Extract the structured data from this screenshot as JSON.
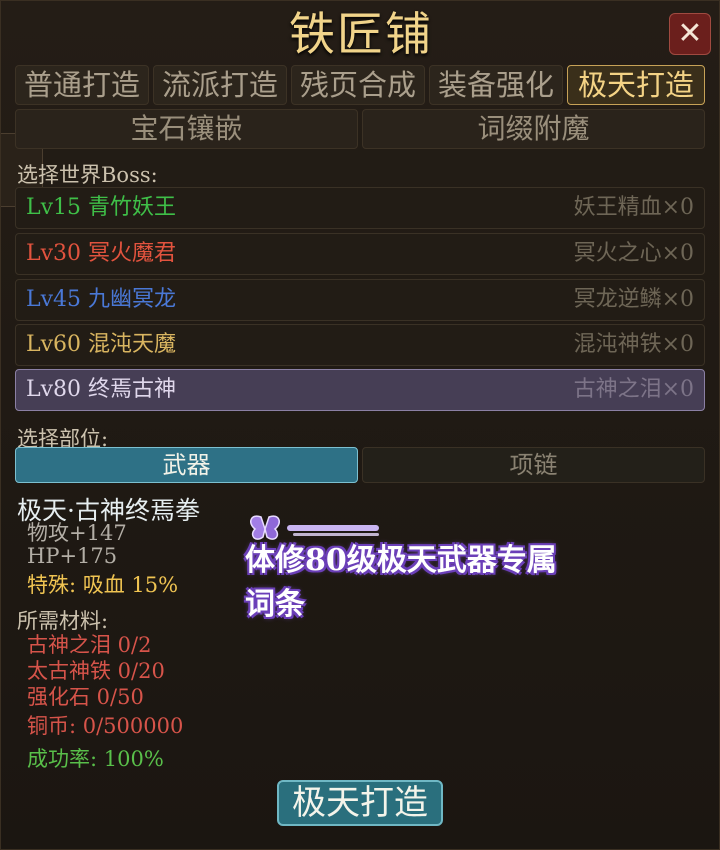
{
  "window": {
    "title": "铁匠铺",
    "close_icon": "close-icon"
  },
  "tabs": [
    {
      "label": "普通打造",
      "active": false
    },
    {
      "label": "流派打造",
      "active": false
    },
    {
      "label": "残页合成",
      "active": false
    },
    {
      "label": "装备强化",
      "active": false
    },
    {
      "label": "极天打造",
      "active": true
    }
  ],
  "subtabs": [
    {
      "label": "宝石镶嵌"
    },
    {
      "label": "词缀附魔"
    }
  ],
  "boss_section": {
    "label": "选择世界Boss:",
    "bosses": [
      {
        "name": "Lv15 青竹妖王",
        "material": "妖王精血×0",
        "color": "#3fbf48",
        "selected": false
      },
      {
        "name": "Lv30 冥火魔君",
        "material": "冥火之心×0",
        "color": "#e2533e",
        "selected": false
      },
      {
        "name": "Lv45 九幽冥龙",
        "material": "冥龙逆鳞×0",
        "color": "#4a78d6",
        "selected": false
      },
      {
        "name": "Lv60 混沌天魔",
        "material": "混沌神铁×0",
        "color": "#d9b560",
        "selected": false
      },
      {
        "name": "Lv80 终焉古神",
        "material": "古神之泪×0",
        "color": "#e0d8ec",
        "selected": true
      }
    ]
  },
  "slot_section": {
    "label": "选择部位:",
    "slots": [
      {
        "label": "武器",
        "active": true
      },
      {
        "label": "项链",
        "active": false
      }
    ]
  },
  "item": {
    "name": "极天·古神终焉拳",
    "stats": [
      "物攻+147",
      "HP+175"
    ],
    "special": "特殊: 吸血 15%"
  },
  "materials": {
    "label": "所需材料:",
    "lines": [
      "古神之泪  0/2",
      "太古神铁  0/20",
      "强化石  0/50",
      "铜币: 0/500000"
    ],
    "success_rate": "成功率: 100%"
  },
  "forge_button": {
    "label": "极天打造"
  },
  "overlay": {
    "text_line1": "体修80级极天武器专属",
    "text_line2": "词条",
    "icon": "butterfly-icon"
  }
}
